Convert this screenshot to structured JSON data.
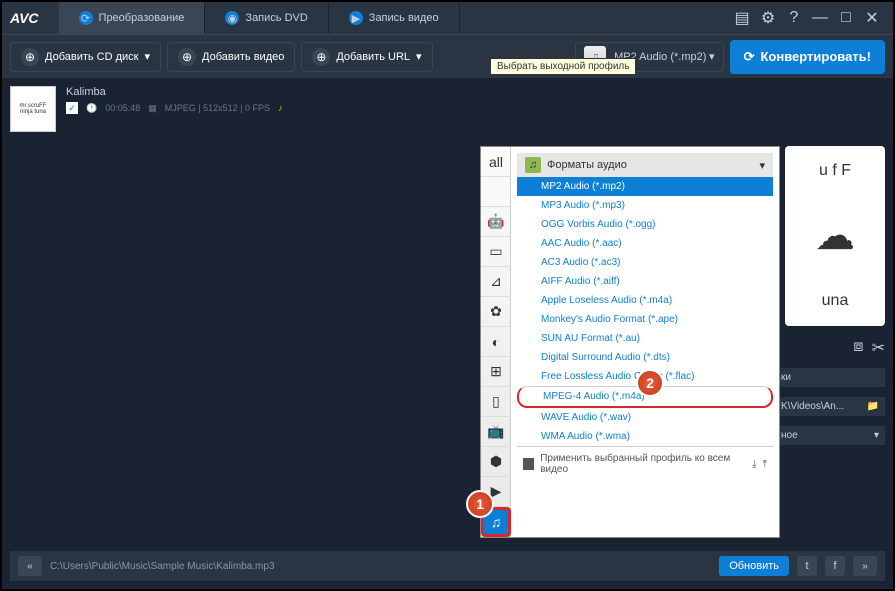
{
  "logo": "AVC",
  "tabs": [
    {
      "label": "Преобразование"
    },
    {
      "label": "Запись DVD"
    },
    {
      "label": "Запись видео"
    }
  ],
  "toolbar": {
    "add_cd": "Добавить CD диск",
    "add_video": "Добавить видео",
    "add_url": "Добавить URL",
    "profile_selected": "MP2 Audio (*.mp2)",
    "convert": "Конвертировать!"
  },
  "tooltip": "Выбрать выходной профиль",
  "file": {
    "thumb_top": "mr.scruFF",
    "thumb_bottom": "ninja tuna",
    "name": "Kalimba",
    "duration": "00:05:48",
    "codec": "MJPEG | 512x512 | 0 FPS"
  },
  "popup": {
    "header": "Форматы аудио",
    "items": [
      "MP2 Audio (*.mp2)",
      "MP3 Audio (*.mp3)",
      "OGG Vorbis Audio (*.ogg)",
      "AAC Audio (*.aac)",
      "AC3 Audio (*.ac3)",
      "AIFF Audio (*.aiff)",
      "Apple Loseless Audio (*.m4a)",
      "Monkey's Audio Format (*.ape)",
      "SUN AU Format (*.au)",
      "Digital Surround Audio (*.dts)",
      "Free Lossless Audio Codec (*.flac)",
      "MPEG-4 Audio (*.m4a)",
      "WAVE Audio (*.wav)",
      "WMA Audio (*.wma)"
    ],
    "footer": "Применить выбранный профиль ко всем видео"
  },
  "badges": {
    "one": "1",
    "two": "2"
  },
  "preview": {
    "top": "u f F",
    "icon": "☁",
    "bottom": "una"
  },
  "side": {
    "tools_label": "ки",
    "path": "K\\Videos\\An...",
    "suffix": "ное"
  },
  "bottom": {
    "path": "C:\\Users\\Public\\Music\\Sample Music\\Kalimba.mp3",
    "update": "Обновить"
  }
}
